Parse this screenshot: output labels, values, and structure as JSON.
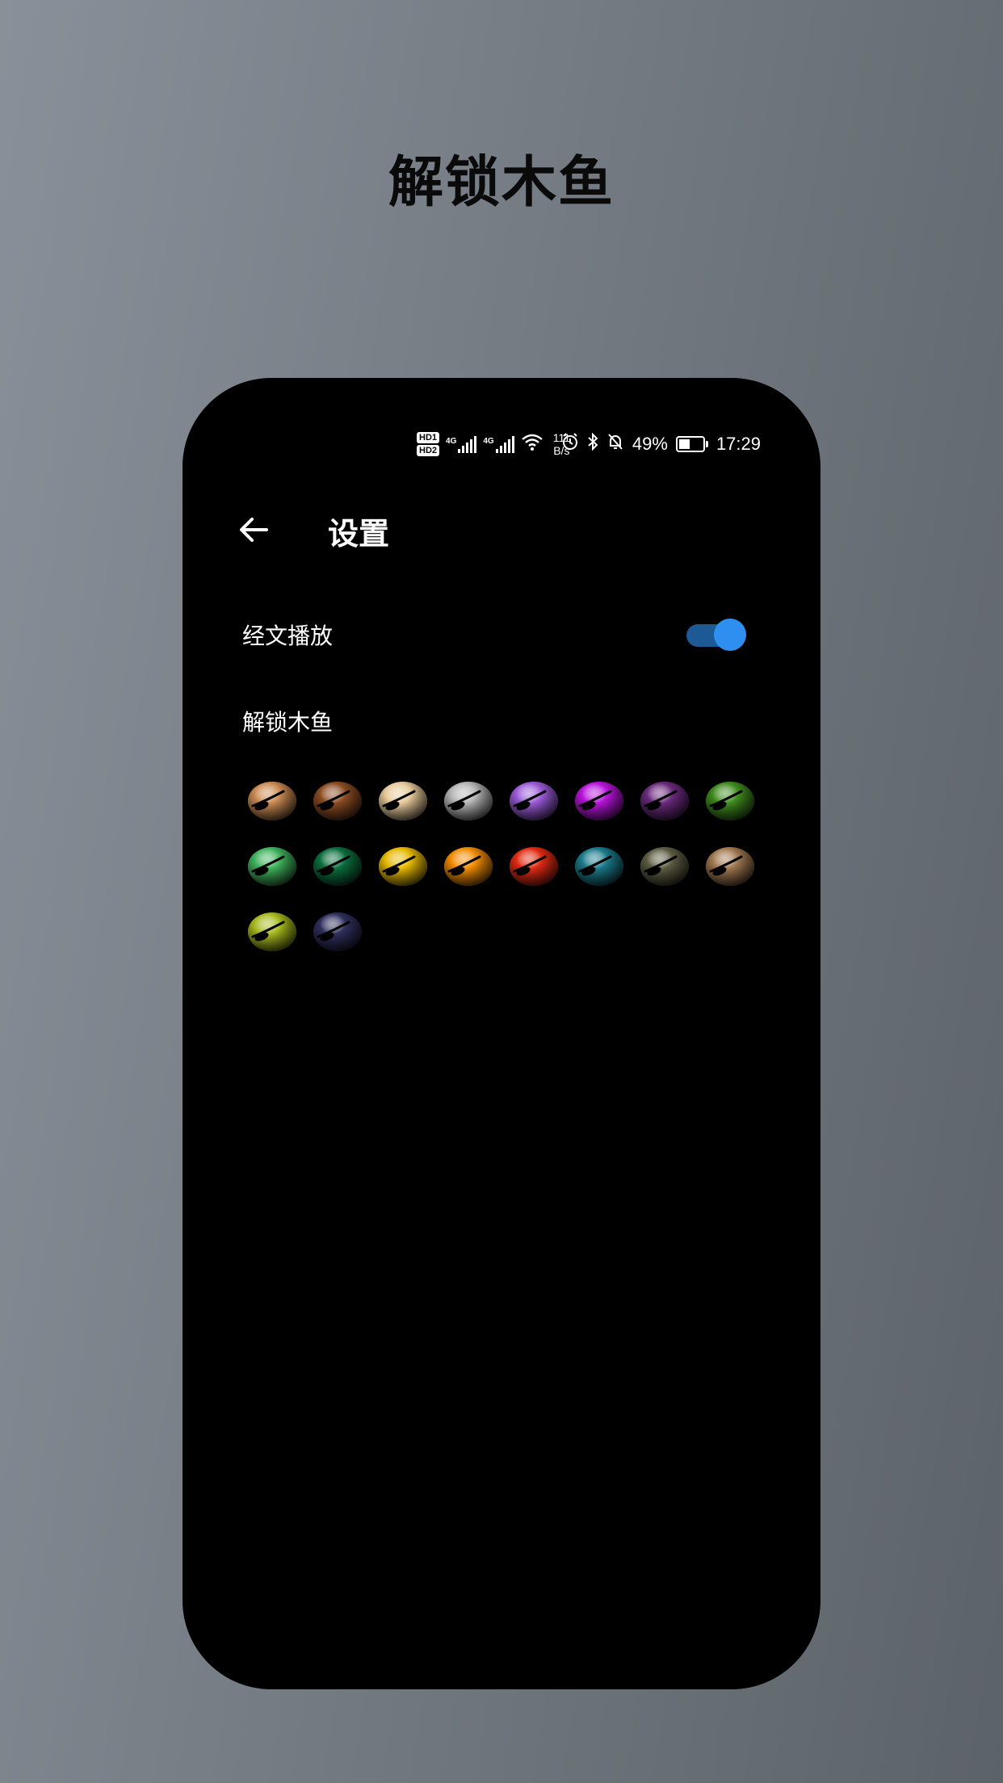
{
  "headline": "解锁木鱼",
  "status_bar": {
    "hd1": "HD1",
    "hd2": "HD2",
    "sim1": "4G",
    "sim2": "4G",
    "speed_value": "111",
    "speed_unit": "B/s",
    "battery": "49%",
    "battery_level": 0.49,
    "time": "17:29"
  },
  "app_bar": {
    "title": "设置"
  },
  "settings": {
    "scripture_play": {
      "label": "经文播放",
      "enabled": true
    },
    "unlock_fish": {
      "label": "解锁木鱼",
      "items": [
        {
          "color": "#c98a52"
        },
        {
          "color": "#8a4b22"
        },
        {
          "color": "#e6c99a"
        },
        {
          "color": "#b4b4b4"
        },
        {
          "color": "#9a5ad6"
        },
        {
          "color": "#b614d9"
        },
        {
          "color": "#6a2a7c"
        },
        {
          "color": "#3e8a1e"
        },
        {
          "color": "#3fb25c"
        },
        {
          "color": "#0c6e3e"
        },
        {
          "color": "#e6b800"
        },
        {
          "color": "#f08c00"
        },
        {
          "color": "#e02a14"
        },
        {
          "color": "#1a7a8a"
        },
        {
          "color": "#5c5c42"
        },
        {
          "color": "#a07850"
        },
        {
          "color": "#a6b81e"
        },
        {
          "color": "#2e2e5c"
        }
      ]
    }
  },
  "colors": {
    "accent": "#2e8ff0",
    "toggle_track": "#1d5a95",
    "phone_bg": "#000000"
  }
}
